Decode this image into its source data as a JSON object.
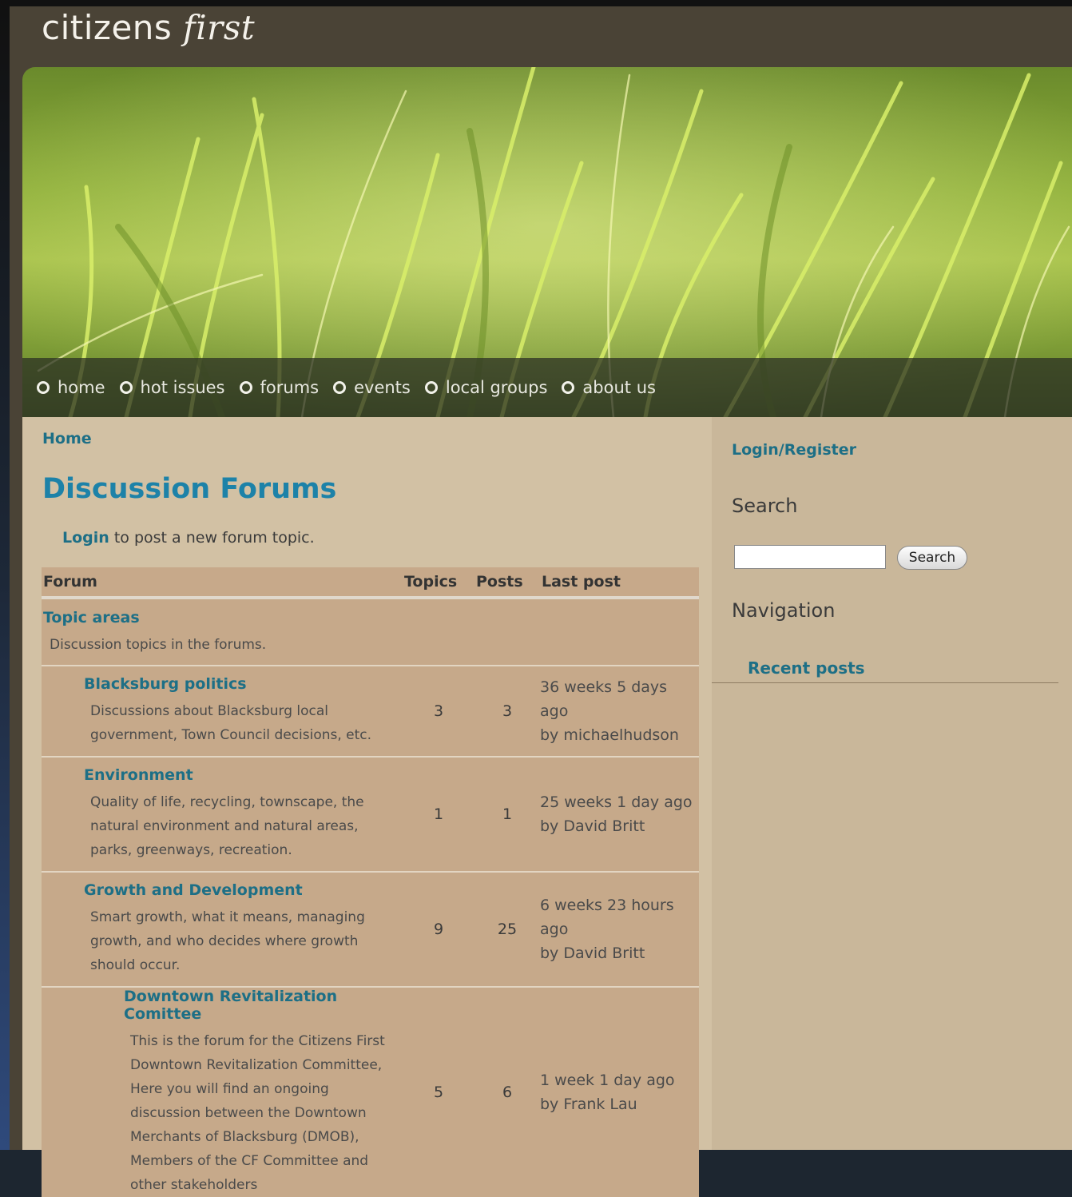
{
  "site": {
    "title_plain": "citizens",
    "title_italic": "first"
  },
  "nav": [
    {
      "label": "home"
    },
    {
      "label": "hot issues"
    },
    {
      "label": "forums"
    },
    {
      "label": "events"
    },
    {
      "label": "local groups"
    },
    {
      "label": "about us"
    }
  ],
  "breadcrumb": "Home",
  "page_title": "Discussion Forums",
  "login_note": {
    "link": "Login",
    "text": " to post a new forum topic."
  },
  "table": {
    "headers": {
      "forum": "Forum",
      "topics": "Topics",
      "posts": "Posts",
      "last": "Last post"
    },
    "category": {
      "name": "Topic areas",
      "desc": "Discussion topics in the forums."
    },
    "rows": [
      {
        "name": "Blacksburg politics",
        "desc": "Discussions about Blacksburg local government, Town Council decisions, etc.",
        "topics": "3",
        "posts": "3",
        "last_time": "36 weeks 5 days ago",
        "last_by": "by michaelhudson"
      },
      {
        "name": "Environment",
        "desc": "Quality of life, recycling, townscape, the natural environment and natural areas, parks, greenways, recreation.",
        "topics": "1",
        "posts": "1",
        "last_time": "25 weeks 1 day ago",
        "last_by": "by David Britt"
      },
      {
        "name": "Growth and Development",
        "desc": "Smart growth, what it means, managing growth, and who decides where growth should occur.",
        "topics": "9",
        "posts": "25",
        "last_time": "6 weeks 23 hours ago",
        "last_by": "by David Britt"
      },
      {
        "name": "Downtown Revitalization Comittee",
        "desc": "This is the forum for the Citizens First Downtown Revitalization Committee, Here you will find an ongoing discussion between the Downtown Merchants of Blacksburg (DMOB), Members of the CF Committee and other stakeholders",
        "topics": "5",
        "posts": "6",
        "last_time": "1 week 1 day ago",
        "last_by": "by Frank Lau"
      }
    ]
  },
  "sidebar": {
    "login": "Login/Register",
    "search_heading": "Search",
    "search_button": "Search",
    "navigation_heading": "Navigation",
    "recent_posts": "Recent posts"
  }
}
